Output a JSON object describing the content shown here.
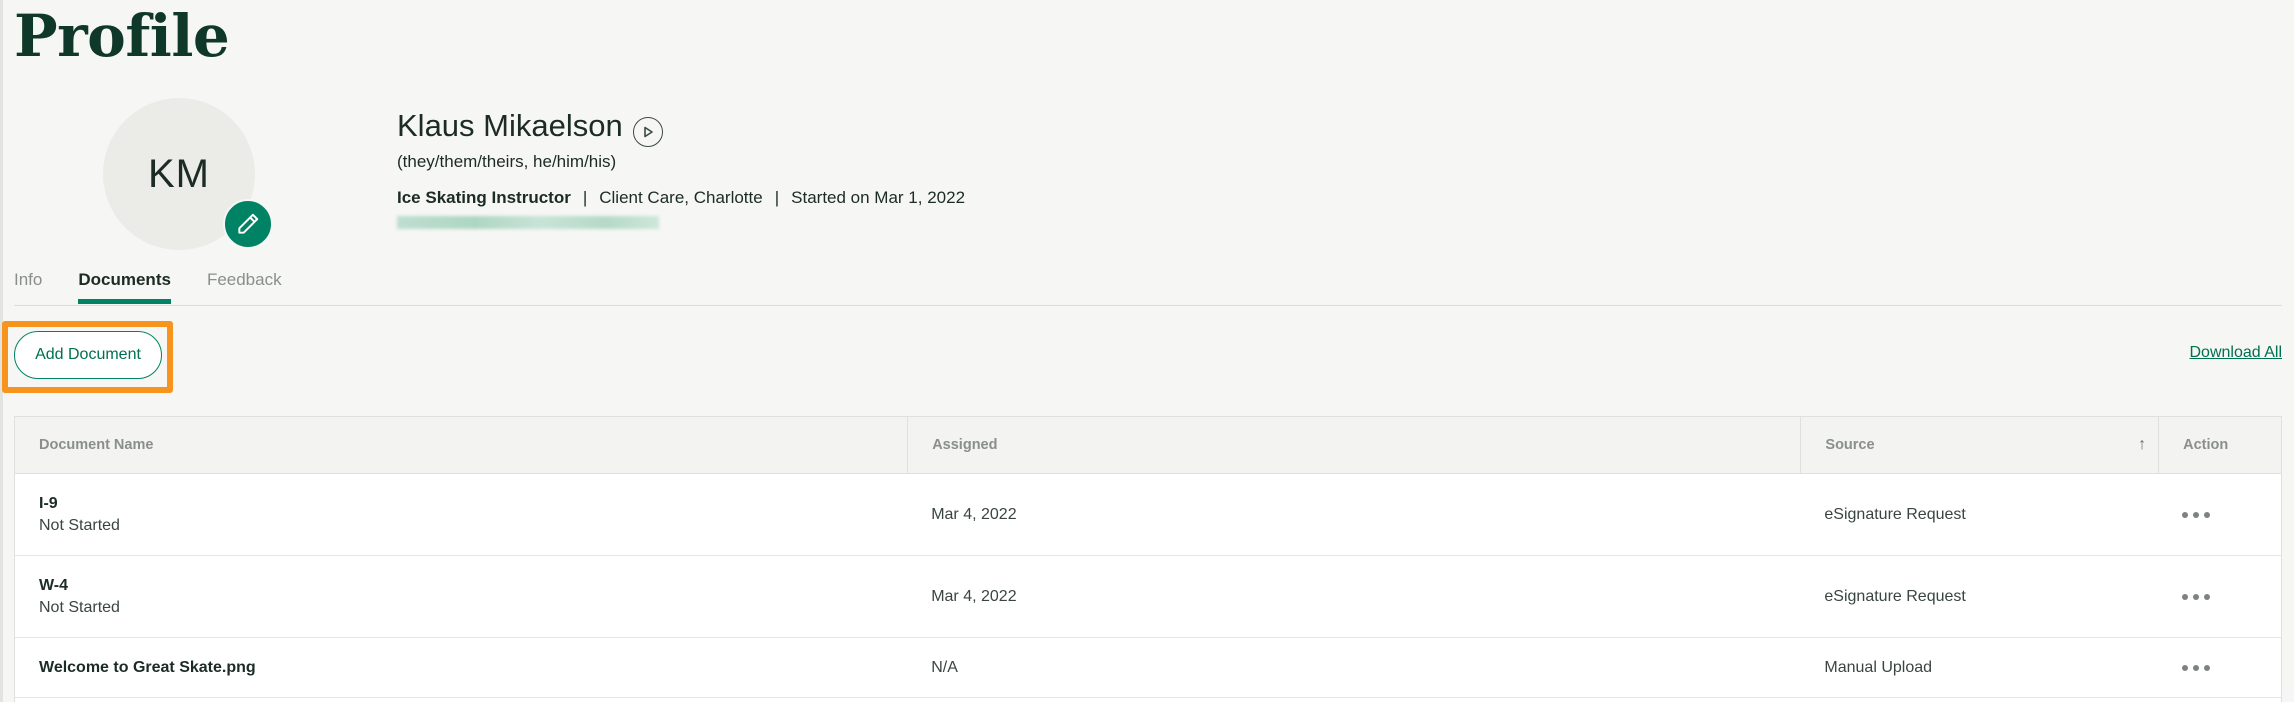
{
  "page": {
    "title": "Profile"
  },
  "employee": {
    "initials": "KM",
    "name": "Klaus Mikaelson",
    "pronouns": "(they/them/theirs, he/him/his)",
    "job_title": "Ice Skating Instructor",
    "separator": "|",
    "department_location": "Client Care, Charlotte",
    "start": "Started on Mar 1, 2022"
  },
  "tabs": [
    {
      "label": "Info",
      "active": false
    },
    {
      "label": "Documents",
      "active": true
    },
    {
      "label": "Feedback",
      "active": false
    }
  ],
  "toolbar": {
    "add_document_label": "Add Document",
    "download_all_label": "Download All"
  },
  "table": {
    "columns": [
      "Document Name",
      "Assigned",
      "Source",
      "Action"
    ],
    "sort_indicator": "↑",
    "rows": [
      {
        "name": "I-9",
        "status": "Not Started",
        "assigned": "Mar 4, 2022",
        "source": "eSignature Request"
      },
      {
        "name": "W-4",
        "status": "Not Started",
        "assigned": "Mar 4, 2022",
        "source": "eSignature Request"
      },
      {
        "name": "Welcome to Great Skate.png",
        "status": "",
        "assigned": "N/A",
        "source": "Manual Upload"
      }
    ]
  },
  "icons": {
    "edit_avatar": "pencil-icon",
    "play": "play-icon",
    "row_action": "more-horizontal-icon"
  },
  "colors": {
    "brand": "#008364",
    "highlight": "#f7941d",
    "title": "#10382a"
  }
}
